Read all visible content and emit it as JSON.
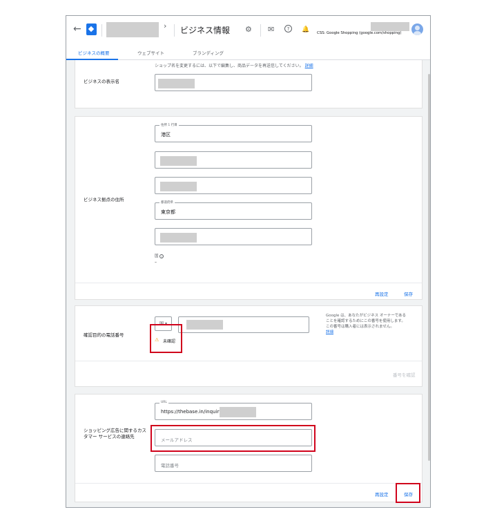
{
  "header": {
    "back_icon": "arrow-back-icon",
    "app_logo_icon": "merchant-center-logo-icon",
    "breadcrumb_chevron": "›",
    "title": "ビジネス情報",
    "settings_icon": "⚙",
    "mail_icon": "✉",
    "help_icon": "?",
    "bell_icon": "🔔",
    "store_label": "CSS: Google Shopping (google.com/shopping)"
  },
  "tabs": [
    {
      "label": "ビジネスの概要",
      "active": true
    },
    {
      "label": "ウェブサイト",
      "active": false
    },
    {
      "label": "ブランディング",
      "active": false
    }
  ],
  "business_name": {
    "helper_text": "ショップ名を変更するには、以下で編集し、商品データを再送信してください。",
    "helper_link": "詳細",
    "label": "ビジネスの表示名"
  },
  "address": {
    "label": "ビジネス拠点の住所",
    "line1_label": "住所 1 行目",
    "line1_value": "港区",
    "prefecture_label": "都道府県",
    "prefecture_value": "東京都",
    "country_label": "国",
    "country_value": "–",
    "reset_label": "再設定",
    "save_label": "保存"
  },
  "phone": {
    "label": "確認目的の電話番号",
    "country_code": "国",
    "status": "未確認",
    "note": "Google は、あなたがビジネス オーナーであることを確認するためにこの番号を使用します。この番号は購入者には表示されません。",
    "note_link": "詳細",
    "verify_label": "番号を確認"
  },
  "customer_service": {
    "label": "ショッピング広告に関するカスタマー サービスの連絡先",
    "url_label": "URL",
    "url_value": "https://thebase.in/inquiry/",
    "email_placeholder": "メールアドレス",
    "phone_placeholder": "電話番号",
    "reset_label": "再設定",
    "save_label": "保存"
  },
  "colors": {
    "accent": "#1a73e8",
    "highlight": "#d0021b",
    "warning": "#f29900"
  }
}
